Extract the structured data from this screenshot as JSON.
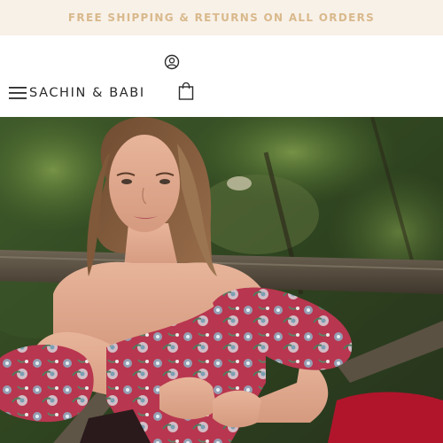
{
  "promo": {
    "text": "FREE SHIPPING & RETURNS ON ALL ORDERS"
  },
  "header": {
    "logo": "SACHIN & BABI",
    "icons": [
      "account-icon",
      "menu-icon",
      "shopping-bag-icon"
    ]
  },
  "colors": {
    "promo_bg": "#f8f1e8",
    "promo_text": "#d9b98c",
    "logo_text": "#2a2a2a",
    "dress_pink": "#b8364f",
    "pants_red": "#b0152c"
  }
}
